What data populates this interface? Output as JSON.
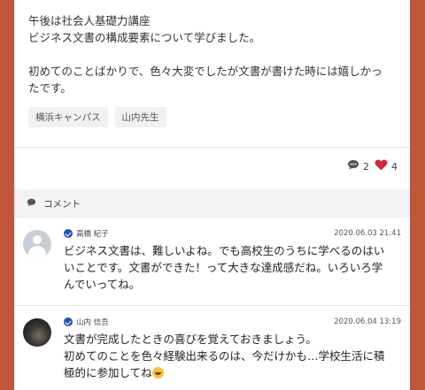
{
  "post": {
    "lines": [
      "午後は社会人基礎力講座",
      "ビジネス文書の構成要素について学びました。",
      "初めてのことばかりで、色々大変でしたが文書が書けた時には嬉しかっ",
      "たです。"
    ],
    "tags": [
      "横浜キャンパス",
      "山内先生"
    ]
  },
  "reactions": {
    "comment_count": "2",
    "like_count": "4"
  },
  "comments_section": {
    "title": "コメント"
  },
  "comments": [
    {
      "author": "高橋 紀子",
      "timestamp": "2020.06.03 21:41",
      "lines": [
        "ビジネス文書は、難しいよね。でも高校生のうちに学べるのはい",
        "いことです。文書ができた！って大きな達成感だね。いろいろ学",
        "んでいってね。"
      ]
    },
    {
      "author": "山内 信吾",
      "timestamp": "2020.06.04 13:19",
      "lines": [
        "文書が完成したときの喜びを覚えておきましょう。",
        "初めてのことを色々経験出来るのは、今だけかも…学校生活に積",
        "極的に参加してね"
      ]
    }
  ],
  "colors": {
    "background": "#c0573a",
    "heart": "#d0283c",
    "verified": "#2453b8"
  },
  "icons": [
    "comment-bubble-icon",
    "heart-icon",
    "verified-check-icon",
    "grinning-emoji-icon"
  ]
}
